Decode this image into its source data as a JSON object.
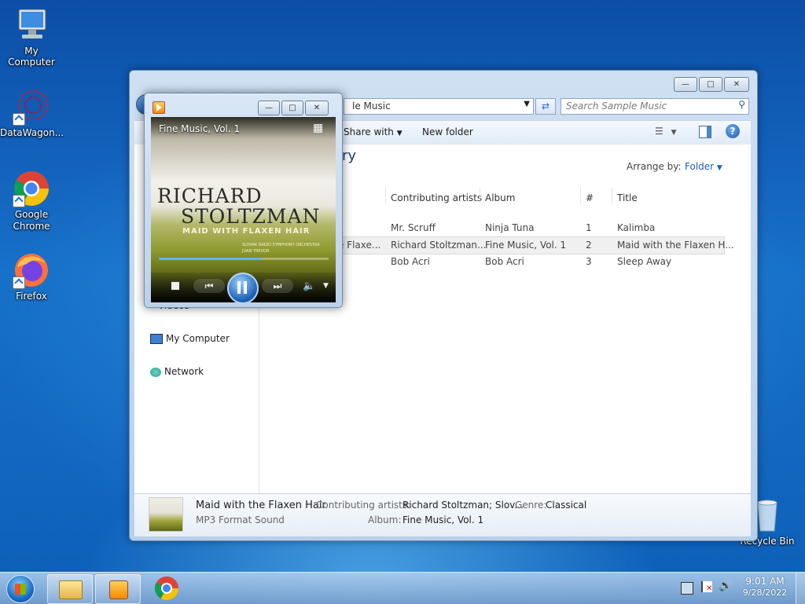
{
  "desktop": {
    "icons": [
      {
        "label": "My Computer"
      },
      {
        "label": "DataWagon..."
      },
      {
        "label": "Google Chrome"
      },
      {
        "label": "Firefox"
      },
      {
        "label": "Recycle Bin"
      }
    ]
  },
  "explorer": {
    "address": "le Music",
    "search_placeholder": "Search Sample Music",
    "toolbar": {
      "share_with": "Share with",
      "new_folder": "New folder"
    },
    "library_title": "ary",
    "arrange_by_label": "Arrange by:",
    "arrange_by_value": "Folder",
    "nav": {
      "videos": "Videos",
      "my_computer": "My Computer",
      "network": "Network"
    },
    "columns": [
      "Contributing artists",
      "Album",
      "#",
      "Title"
    ],
    "rows": [
      {
        "name": "",
        "artist": "Mr. Scruff",
        "album": "Ninja Tuna",
        "num": "1",
        "title": "Kalimba"
      },
      {
        "name": "e Flaxe...",
        "artist": "Richard Stoltzman...",
        "album": "Fine Music, Vol. 1",
        "num": "2",
        "title": "Maid with the Flaxen H..."
      },
      {
        "name": "",
        "artist": "Bob Acri",
        "album": "Bob Acri",
        "num": "3",
        "title": "Sleep Away"
      }
    ],
    "details": {
      "title": "Maid with the Flaxen Hair",
      "type": "MP3 Format Sound",
      "artists_label": "Contributing artists:",
      "artists_value": "Richard Stoltzman; Slov...",
      "genre_label": "Genre:",
      "genre_value": "Classical",
      "album_label": "Album:",
      "album_value": "Fine Music, Vol. 1"
    }
  },
  "player": {
    "now_playing": "Fine Music, Vol. 1",
    "art_line1": "RICHARD",
    "art_line2": "STOLTZMAN",
    "art_line3": "MAID WITH FLAXEN HAIR",
    "art_line4": "SLOVAK RADIO SYMPHONY ORCHESTRA",
    "art_line5": "JUAN TREVOR",
    "progress": 0.6
  },
  "taskbar": {
    "time": "9:01 AM",
    "date": "9/28/2022"
  },
  "colors": {
    "link": "#1e5fae",
    "accent": "#2b6ec9"
  }
}
